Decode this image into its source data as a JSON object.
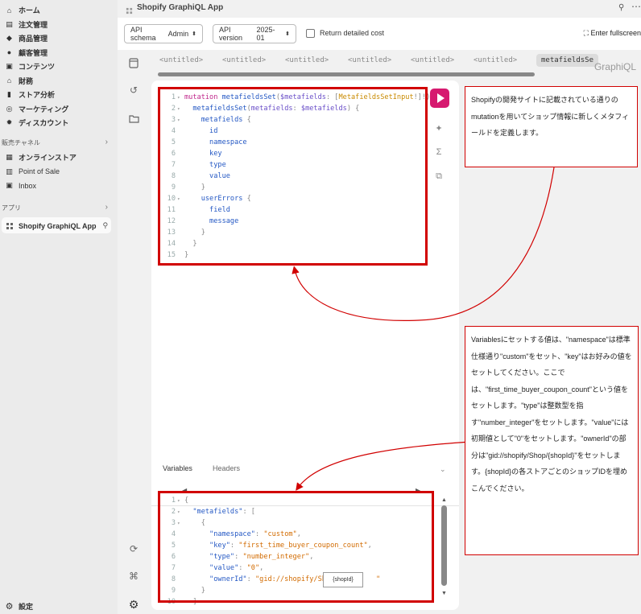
{
  "sidebar": {
    "items": [
      {
        "label": "ホーム",
        "icon": "home-icon"
      },
      {
        "label": "注文管理",
        "icon": "orders-icon"
      },
      {
        "label": "商品管理",
        "icon": "tag-icon"
      },
      {
        "label": "顧客管理",
        "icon": "person-icon"
      },
      {
        "label": "コンテンツ",
        "icon": "content-icon"
      },
      {
        "label": "財務",
        "icon": "bank-icon"
      },
      {
        "label": "ストア分析",
        "icon": "chart-icon"
      },
      {
        "label": "マーケティング",
        "icon": "target-icon"
      },
      {
        "label": "ディスカウント",
        "icon": "discount-icon"
      }
    ],
    "channels_header": "販売チャネル",
    "channels": [
      {
        "label": "オンラインストア",
        "icon": "store-icon"
      },
      {
        "label": "Point of Sale",
        "icon": "pos-icon"
      },
      {
        "label": "Inbox",
        "icon": "inbox-icon"
      }
    ],
    "apps_header": "アプリ",
    "app": {
      "label": "Shopify GraphiQL App",
      "icon": "app-icon",
      "pin": "pin-icon"
    },
    "settings": {
      "label": "設定",
      "icon": "gear-icon"
    }
  },
  "topbar": {
    "title": "Shopify GraphiQL App"
  },
  "toolbar": {
    "schema_prefix": "API schema",
    "schema_value": "Admin",
    "version_prefix": "API version",
    "version_value": "2025-01",
    "return_detailed_cost": "Return detailed cost",
    "fullscreen": "Enter fullscreen"
  },
  "tabs": [
    "<untitled>",
    "<untitled>",
    "<untitled>",
    "<untitled>",
    "<untitled>",
    "<untitled>",
    "metafieldsSe"
  ],
  "graphiql_logo": "GraphiQL",
  "query_lines": [
    [
      {
        "t": "mutation ",
        "c": "kw"
      },
      {
        "t": "metafieldsSet",
        "c": "fn"
      },
      {
        "t": "(",
        "c": "pu"
      },
      {
        "t": "$metafields",
        "c": "va"
      },
      {
        "t": ": [",
        "c": "pu"
      },
      {
        "t": "MetafieldsSetInput",
        "c": "ty"
      },
      {
        "t": "!]!) {",
        "c": "pu"
      }
    ],
    [
      {
        "t": "  metafieldsSet",
        "c": "fld"
      },
      {
        "t": "(",
        "c": "pu"
      },
      {
        "t": "metafields",
        "c": "va"
      },
      {
        "t": ": ",
        "c": "pu"
      },
      {
        "t": "$metafields",
        "c": "va"
      },
      {
        "t": ") {",
        "c": "pu"
      }
    ],
    [
      {
        "t": "    metafields ",
        "c": "fld"
      },
      {
        "t": "{",
        "c": "pu"
      }
    ],
    [
      {
        "t": "      id",
        "c": "fld"
      }
    ],
    [
      {
        "t": "      namespace",
        "c": "fld"
      }
    ],
    [
      {
        "t": "      key",
        "c": "fld"
      }
    ],
    [
      {
        "t": "      type",
        "c": "fld"
      }
    ],
    [
      {
        "t": "      value",
        "c": "fld"
      }
    ],
    [
      {
        "t": "    }",
        "c": "pu"
      }
    ],
    [
      {
        "t": "    userErrors ",
        "c": "fld"
      },
      {
        "t": "{",
        "c": "pu"
      }
    ],
    [
      {
        "t": "      field",
        "c": "fld"
      }
    ],
    [
      {
        "t": "      message",
        "c": "fld"
      }
    ],
    [
      {
        "t": "    }",
        "c": "pu"
      }
    ],
    [
      {
        "t": "  }",
        "c": "pu"
      }
    ],
    [
      {
        "t": "}",
        "c": "pu"
      }
    ]
  ],
  "query_fold_lines": [
    1,
    2,
    3,
    10
  ],
  "variables_tab": "Variables",
  "headers_tab": "Headers",
  "variable_lines": [
    [
      {
        "t": "{",
        "c": "pu"
      }
    ],
    [
      {
        "t": "  \"metafields\"",
        "c": "key"
      },
      {
        "t": ": [",
        "c": "pu"
      }
    ],
    [
      {
        "t": "    {",
        "c": "pu"
      }
    ],
    [
      {
        "t": "      \"namespace\"",
        "c": "key"
      },
      {
        "t": ": ",
        "c": "pu"
      },
      {
        "t": "\"custom\"",
        "c": "str"
      },
      {
        "t": ",",
        "c": "pu"
      }
    ],
    [
      {
        "t": "      \"key\"",
        "c": "key"
      },
      {
        "t": ": ",
        "c": "pu"
      },
      {
        "t": "\"first_time_buyer_coupon_count\"",
        "c": "str"
      },
      {
        "t": ",",
        "c": "pu"
      }
    ],
    [
      {
        "t": "      \"type\"",
        "c": "key"
      },
      {
        "t": ": ",
        "c": "pu"
      },
      {
        "t": "\"number_integer\"",
        "c": "str"
      },
      {
        "t": ",",
        "c": "pu"
      }
    ],
    [
      {
        "t": "      \"value\"",
        "c": "key"
      },
      {
        "t": ": ",
        "c": "pu"
      },
      {
        "t": "\"0\"",
        "c": "str"
      },
      {
        "t": ",",
        "c": "pu"
      }
    ],
    [
      {
        "t": "      \"ownerId\"",
        "c": "key"
      },
      {
        "t": ": ",
        "c": "pu"
      },
      {
        "t": "\"gid://shopify/Shop/",
        "c": "str"
      },
      {
        "t": "         \"",
        "c": "str"
      }
    ],
    [
      {
        "t": "    }",
        "c": "pu"
      }
    ],
    [
      {
        "t": "  ]",
        "c": "pu"
      }
    ]
  ],
  "variable_fold_lines": [
    1,
    2,
    3
  ],
  "shopid_label": "{shopId}",
  "callout1": "Shopifyの開発サイトに記載されている通りのmutationを用いてショップ情報に新しくメタフィールドを定義します。",
  "callout2": "Variablesにセットする値は、\"namespace\"は標準仕様通り\"custom\"をセット、\"key\"はお好みの値をセットしてください。ここでは、\"first_time_buyer_coupon_count\"という値をセットします。\"type\"は整数型を指す\"number_integer\"をセットします。\"value\"には初期値として\"0\"をセットします。\"ownerId\"の部分は\"gid://shopify/Shop/{shopId}\"をセットします。{shopId}の各ストアごとのショップIDを埋めこんでください。",
  "colors": {
    "accent_run": "#d6196f",
    "annotation_red": "#d10000"
  }
}
